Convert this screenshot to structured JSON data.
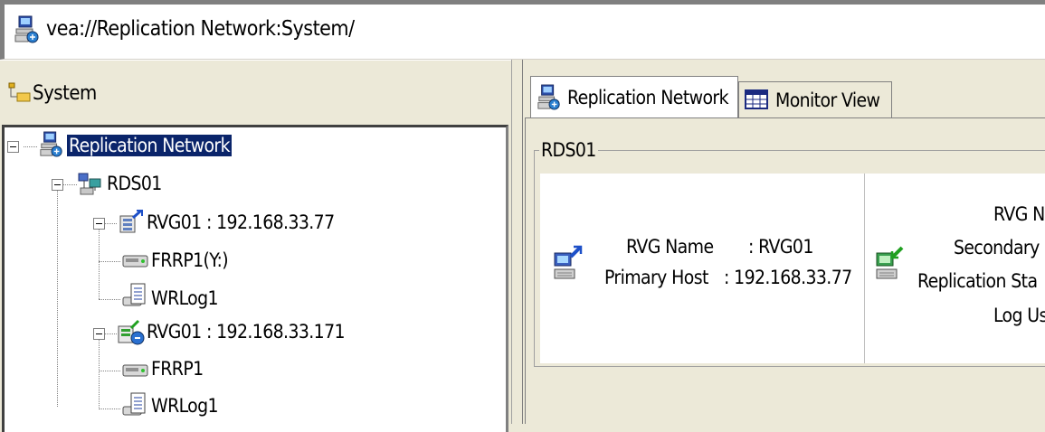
{
  "address_bar": {
    "path": "vea://Replication Network:System/"
  },
  "left_pane": {
    "title": "System"
  },
  "tree": {
    "root": "Replication Network",
    "rds": "RDS01",
    "rvg_primary": {
      "label": "RVG01 : 192.168.33.77",
      "children": [
        "FRRP1(Y:)",
        "WRLog1"
      ]
    },
    "rvg_secondary": {
      "label": "RVG01 : 192.168.33.171",
      "children": [
        "FRRP1",
        "WRLog1"
      ]
    }
  },
  "tabs": [
    {
      "label": "Replication Network",
      "selected": true
    },
    {
      "label": "Monitor View",
      "selected": false
    }
  ],
  "group": {
    "title": "RDS01"
  },
  "primary_card": {
    "rvg_name_label": "RVG Name",
    "rvg_name_value": ": RVG01",
    "primary_host_label": "Primary Host",
    "primary_host_value": ": 192.168.33.77"
  },
  "secondary_card": {
    "rvg_name_label": "RVG Na",
    "secondary_host_label": "Secondary H",
    "replication_status_label": "Replication Sta",
    "log_usage_label": "Log Us"
  },
  "icons": {
    "network": "network-computer-icon",
    "system": "system-tree-icon",
    "rds": "rds-hosts-icon",
    "rvg_primary": "rvg-primary-icon",
    "rvg_secondary": "rvg-secondary-icon",
    "volume": "volume-drive-icon",
    "log": "replicator-log-icon",
    "monitor": "monitor-grid-icon",
    "host_primary": "primary-host-icon",
    "host_secondary": "secondary-host-icon"
  },
  "colors": {
    "selection": "#0a246a",
    "background": "#ece9d8"
  }
}
